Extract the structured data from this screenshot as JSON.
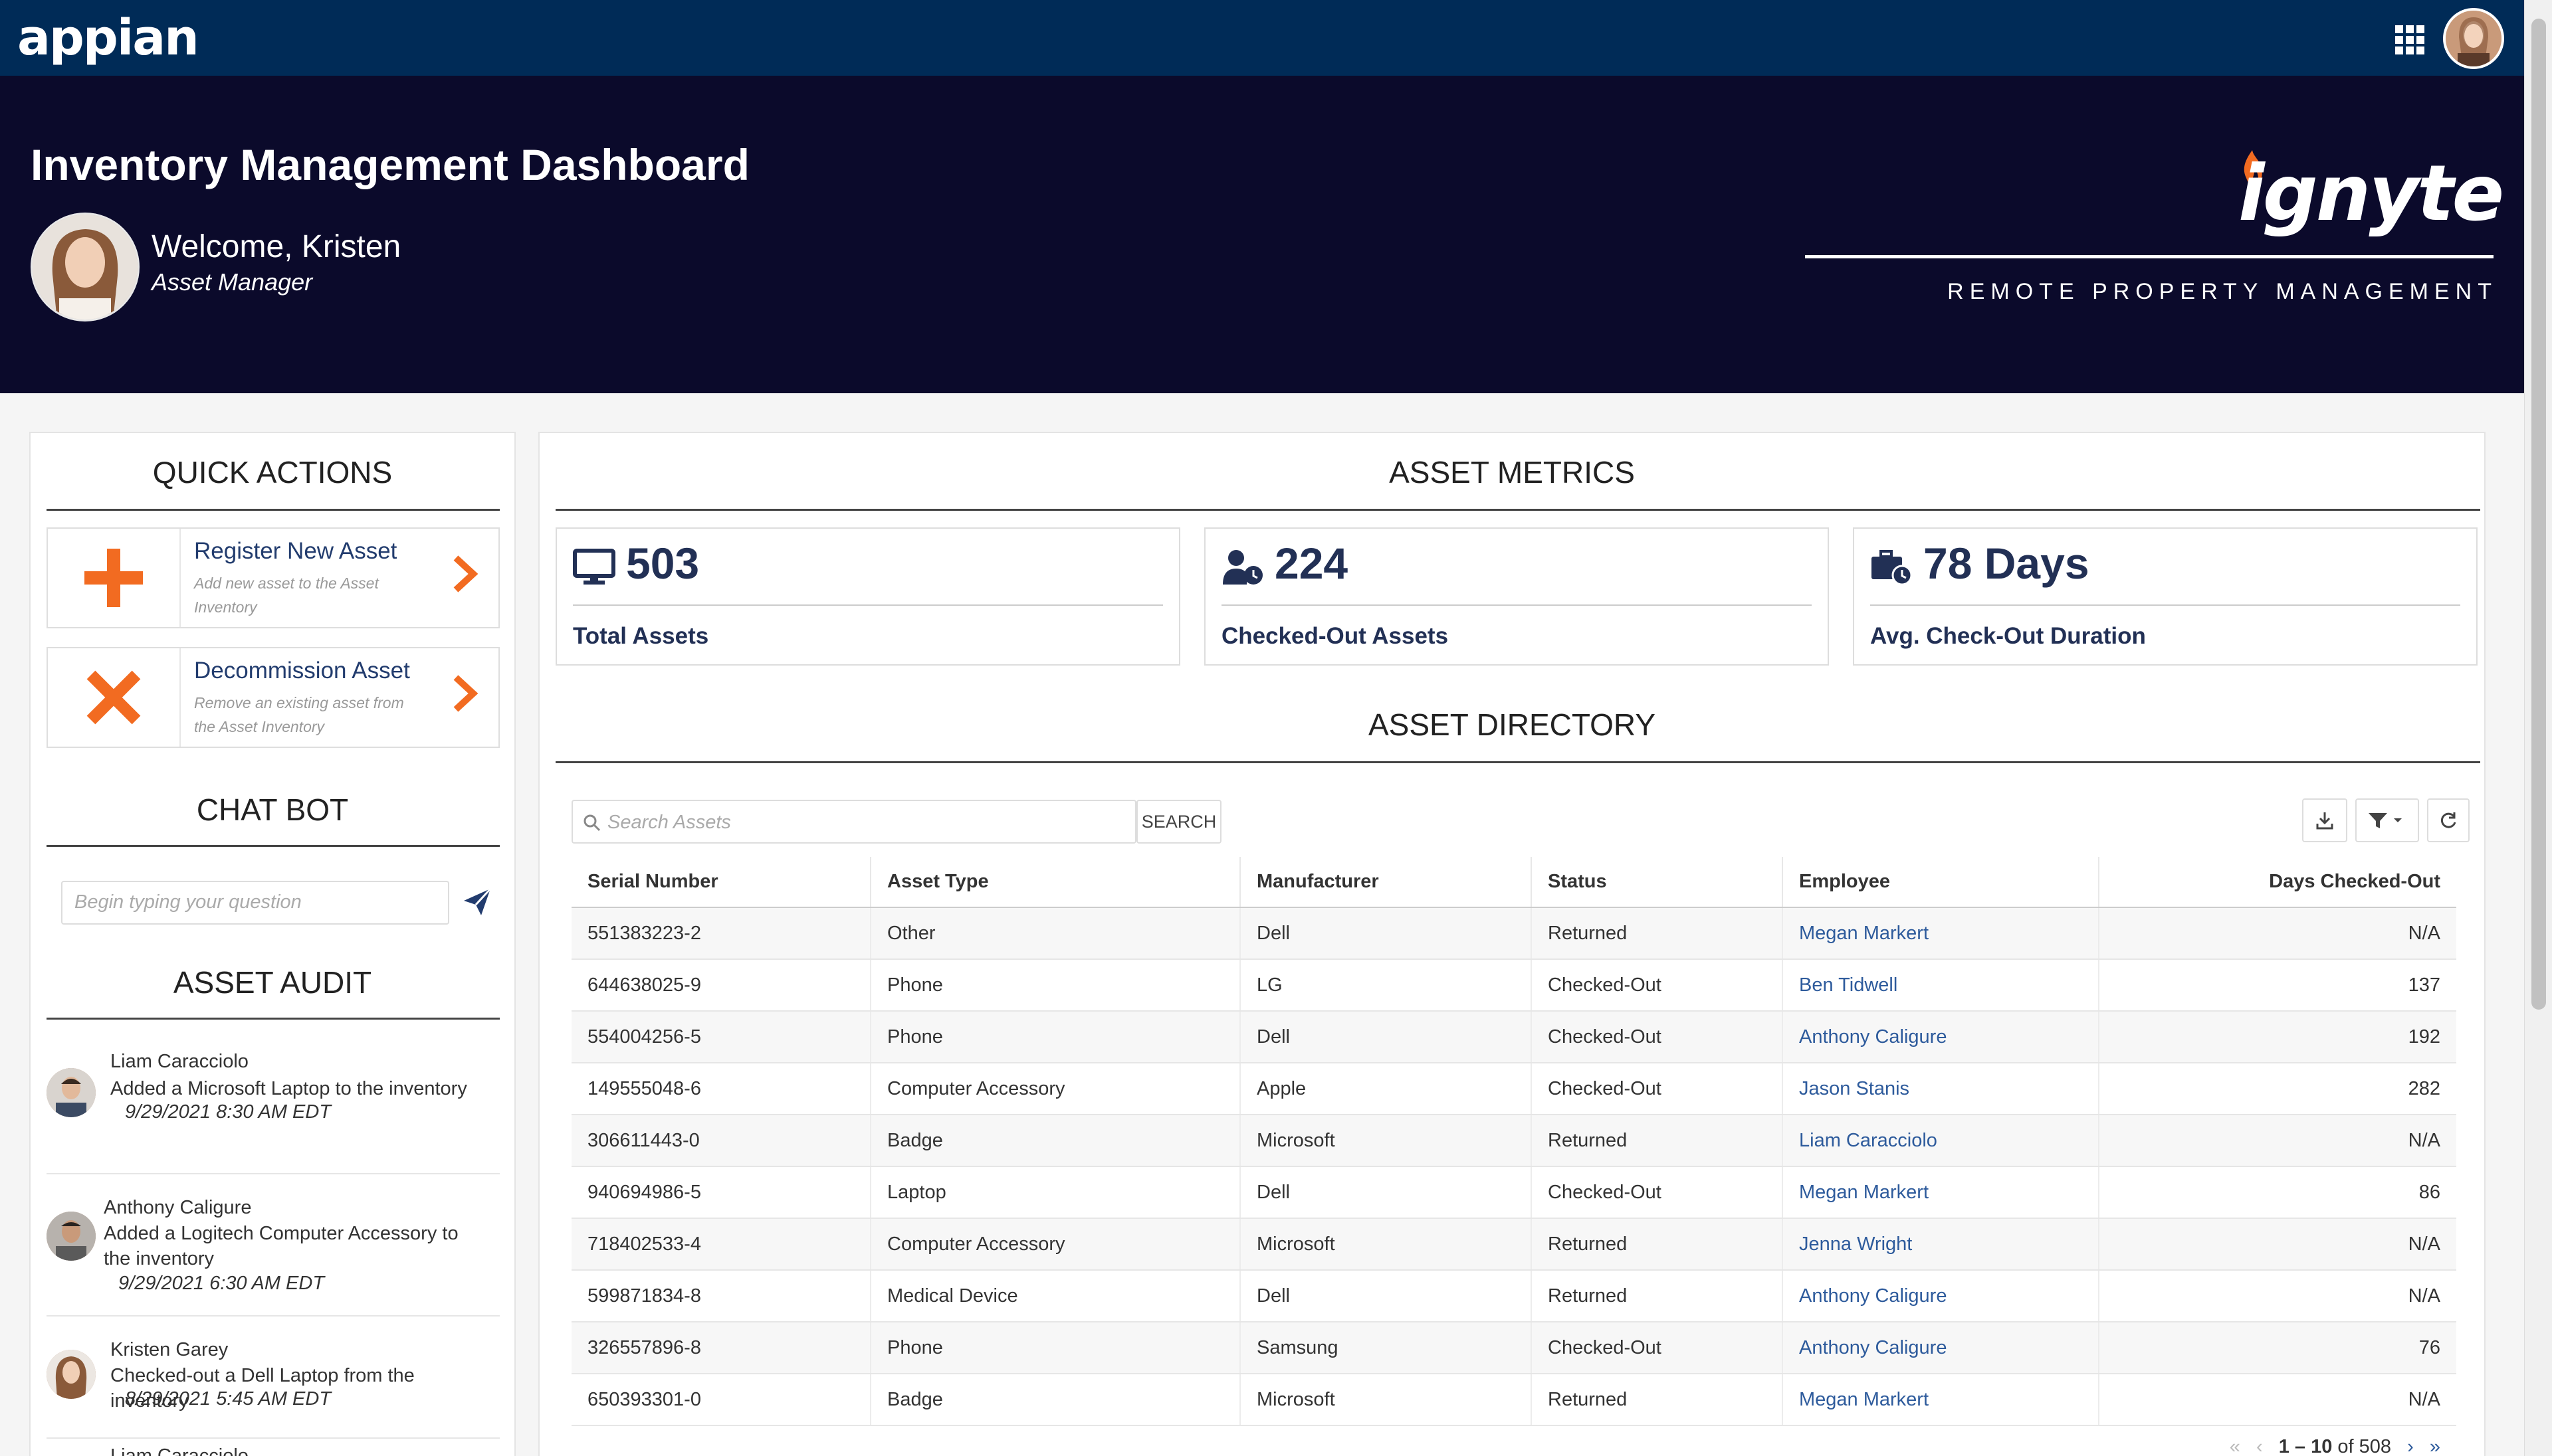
{
  "topbar": {
    "logo_text": "appian",
    "apps_icon": "grid-icon",
    "avatar_icon": "user-avatar"
  },
  "hero": {
    "title": "Inventory Management Dashboard",
    "welcome": "Welcome, Kristen",
    "role": "Asset Manager",
    "brand_logo": "ignyte",
    "brand_tagline": "REMOTE PROPERTY MANAGEMENT"
  },
  "quick_actions": {
    "heading": "QUICK ACTIONS",
    "items": [
      {
        "title": "Register New Asset",
        "description": "Add new asset to the Asset Inventory",
        "icon": "plus-icon"
      },
      {
        "title": "Decommission Asset",
        "description": "Remove an existing asset from the Asset Inventory",
        "icon": "x-icon"
      }
    ]
  },
  "chat_bot": {
    "heading": "CHAT BOT",
    "placeholder": "Begin typing your question"
  },
  "asset_audit": {
    "heading": "ASSET AUDIT",
    "items": [
      {
        "name": "Liam Caracciolo",
        "text": "Added a Microsoft Laptop to the inventory",
        "date": "9/29/2021 8:30 AM EDT"
      },
      {
        "name": "Anthony Caligure",
        "text": "Added a Logitech Computer Accessory to the inventory",
        "date": "9/29/2021 6:30 AM EDT"
      },
      {
        "name": "Kristen Garey",
        "text": "Checked-out a Dell Laptop from the inventory",
        "date": "8/29/2021 5:45 AM EDT"
      },
      {
        "name": "Liam Caracciolo",
        "text": "",
        "date": ""
      }
    ]
  },
  "asset_metrics": {
    "heading": "ASSET METRICS",
    "cards": [
      {
        "value": "503",
        "label": "Total Assets",
        "icon": "monitor-icon"
      },
      {
        "value": "224",
        "label": "Checked-Out Assets",
        "icon": "user-clock-icon"
      },
      {
        "value": "78 Days",
        "label": "Avg. Check-Out Duration",
        "icon": "briefcase-clock-icon"
      }
    ]
  },
  "asset_directory": {
    "heading": "ASSET DIRECTORY",
    "search_placeholder": "Search Assets",
    "search_button": "SEARCH",
    "columns": [
      "Serial Number",
      "Asset Type",
      "Manufacturer",
      "Status",
      "Employee",
      "Days Checked-Out"
    ],
    "rows": [
      [
        "551383223-2",
        "Other",
        "Dell",
        "Returned",
        "Megan Markert",
        "N/A"
      ],
      [
        "644638025-9",
        "Phone",
        "LG",
        "Checked-Out",
        "Ben Tidwell",
        "137"
      ],
      [
        "554004256-5",
        "Phone",
        "Dell",
        "Checked-Out",
        "Anthony Caligure",
        "192"
      ],
      [
        "149555048-6",
        "Computer Accessory",
        "Apple",
        "Checked-Out",
        "Jason Stanis",
        "282"
      ],
      [
        "306611443-0",
        "Badge",
        "Microsoft",
        "Returned",
        "Liam Caracciolo",
        "N/A"
      ],
      [
        "940694986-5",
        "Laptop",
        "Dell",
        "Checked-Out",
        "Megan Markert",
        "86"
      ],
      [
        "718402533-4",
        "Computer Accessory",
        "Microsoft",
        "Returned",
        "Jenna Wright",
        "N/A"
      ],
      [
        "599871834-8",
        "Medical Device",
        "Dell",
        "Returned",
        "Anthony Caligure",
        "N/A"
      ],
      [
        "326557896-8",
        "Phone",
        "Samsung",
        "Checked-Out",
        "Anthony Caligure",
        "76"
      ],
      [
        "650393301-0",
        "Badge",
        "Microsoft",
        "Returned",
        "Megan Markert",
        "N/A"
      ]
    ],
    "pager": {
      "range": "1 – 10",
      "of_label": "of 508"
    }
  },
  "colors": {
    "topbar": "#002b57",
    "hero": "#0b0a2b",
    "accent": "#f26b21",
    "link": "#2e5b9c",
    "heading_dark": "#223055"
  }
}
